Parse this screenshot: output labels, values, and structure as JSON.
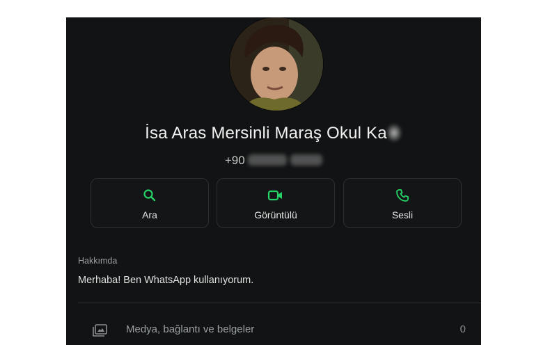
{
  "contact": {
    "name": "İsa Aras Mersinli Maraş Okul Ka",
    "phone": "+90"
  },
  "actions": [
    {
      "label": "Ara",
      "icon": "search-icon"
    },
    {
      "label": "Görüntülü",
      "icon": "video-icon"
    },
    {
      "label": "Sesli",
      "icon": "phone-icon"
    }
  ],
  "about": {
    "title": "Hakkımda",
    "text": "Merhaba! Ben WhatsApp kullanıyorum."
  },
  "media": {
    "label": "Medya, bağlantı ve belgeler",
    "count": "0",
    "icon": "media-icon"
  },
  "colors": {
    "accent": "#25d366",
    "background": "#121314"
  }
}
